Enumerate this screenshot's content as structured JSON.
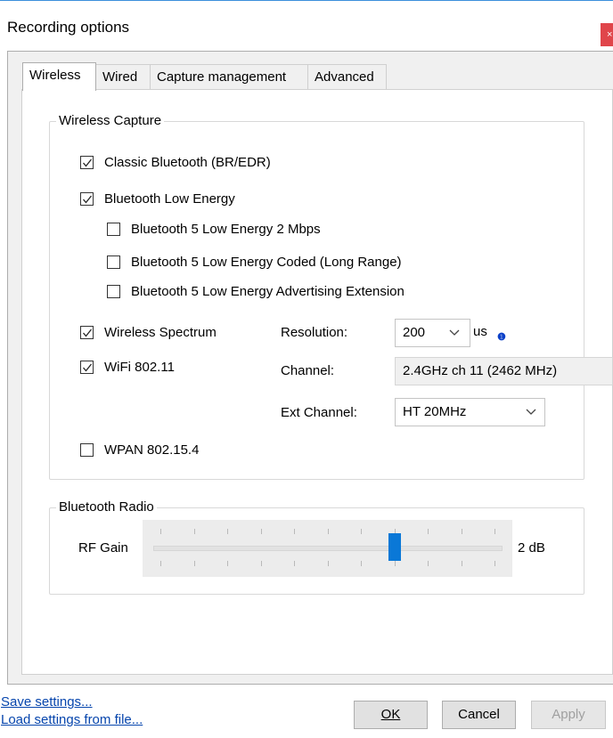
{
  "window": {
    "title": "Recording options",
    "close_glyph": "×"
  },
  "tabs": [
    {
      "label": "Wireless",
      "active": true
    },
    {
      "label": "Wired",
      "active": false
    },
    {
      "label": "Capture management",
      "active": false
    },
    {
      "label": "Advanced",
      "active": false
    }
  ],
  "wireless_capture": {
    "legend": "Wireless Capture",
    "options": {
      "classic_bt": {
        "label": "Classic Bluetooth (BR/EDR)",
        "checked": true
      },
      "ble": {
        "label": "Bluetooth Low Energy",
        "checked": true
      },
      "ble_2m": {
        "label": "Bluetooth 5 Low Energy 2 Mbps",
        "checked": false
      },
      "ble_coded": {
        "label": "Bluetooth 5 Low Energy Coded (Long Range)",
        "checked": false
      },
      "ble_adv": {
        "label": "Bluetooth 5 Low Energy Advertising Extension",
        "checked": false
      },
      "spectrum": {
        "label": "Wireless Spectrum",
        "checked": true
      },
      "wifi": {
        "label": "WiFi 802.11",
        "checked": true
      },
      "wpan": {
        "label": "WPAN 802.15.4",
        "checked": false
      }
    },
    "resolution": {
      "label": "Resolution:",
      "value": "200",
      "unit": "us",
      "info_icon": "info-icon"
    },
    "channel": {
      "label": "Channel:",
      "value": "2.4GHz ch 11 (2462 MHz)"
    },
    "ext_channel": {
      "label": "Ext Channel:",
      "value": "HT 20MHz"
    }
  },
  "bluetooth_radio": {
    "legend": "Bluetooth Radio",
    "rf_gain": {
      "label": "RF Gain",
      "value_text": "2 dB",
      "slider_fraction": 0.7
    }
  },
  "footer": {
    "save_link": "Save settings...",
    "load_link": "Load settings from file...",
    "ok_label": "OK",
    "cancel_label": "Cancel",
    "apply_label": "Apply"
  },
  "colors": {
    "accent": "#0a78d7",
    "close": "#e0454a",
    "link": "#0645ad"
  }
}
